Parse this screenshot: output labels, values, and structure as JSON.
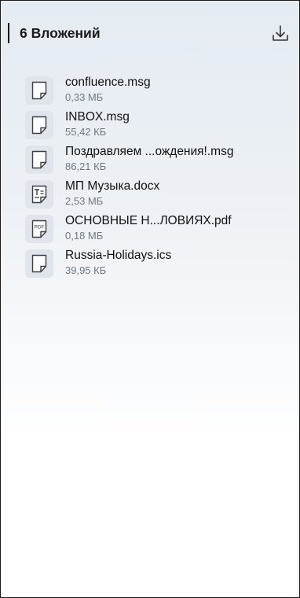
{
  "header": {
    "title": "6 Вложений"
  },
  "attachments": [
    {
      "name": "confluence.msg",
      "size": "0,33 МБ",
      "icon": "generic-file-icon"
    },
    {
      "name": "INBOX.msg",
      "size": "55,42 КБ",
      "icon": "generic-file-icon"
    },
    {
      "name": "Поздравляем ...ождения!.msg",
      "size": "86,21 КБ",
      "icon": "generic-file-icon"
    },
    {
      "name": "МП Музыка.docx",
      "size": "2,53 МБ",
      "icon": "text-document-icon"
    },
    {
      "name": "ОСНОВНЫЕ Н...ЛОВИЯХ.pdf",
      "size": "0,18 МБ",
      "icon": "pdf-file-icon",
      "icon_label": "PDF"
    },
    {
      "name": "Russia-Holidays.ics",
      "size": "39,95 КБ",
      "icon": "generic-file-icon"
    }
  ]
}
